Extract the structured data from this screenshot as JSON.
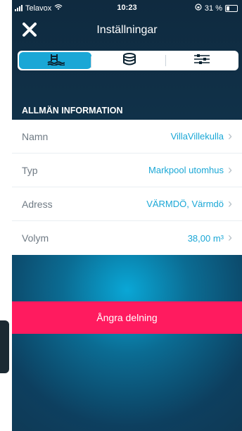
{
  "status_bar": {
    "carrier": "Telavox",
    "time": "10:23",
    "battery": "31 %"
  },
  "nav": {
    "title": "Inställningar"
  },
  "tabs": [
    {
      "name": "pool-tab",
      "icon": "pool-icon"
    },
    {
      "name": "equipment-tab",
      "icon": "disc-stack-icon"
    },
    {
      "name": "settings-tab",
      "icon": "sliders-icon"
    }
  ],
  "section": {
    "title": "ALLMÄN INFORMATION"
  },
  "rows": [
    {
      "label": "Namn",
      "value": "VillaVillekulla"
    },
    {
      "label": "Typ",
      "value": "Markpool utomhus"
    },
    {
      "label": "Adress",
      "value": "VÄRMDÖ, Värmdö"
    },
    {
      "label": "Volym",
      "value": "38,00 m³"
    }
  ],
  "action": {
    "label": "Ångra delning"
  },
  "colors": {
    "accent": "#1aa7d6",
    "danger": "#ff1b5f"
  }
}
